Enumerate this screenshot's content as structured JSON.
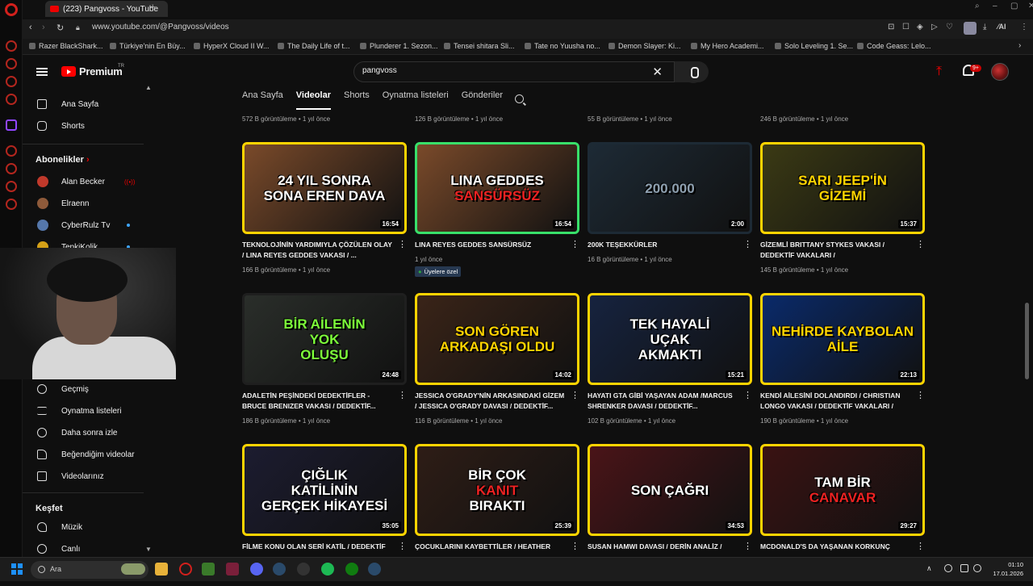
{
  "browser": {
    "tab_title": "(223) Pangvoss - YouTube",
    "tab_add": "+",
    "url": "www.youtube.com/@Pangvoss/videos",
    "bookmarks": [
      "Razer BlackShark...",
      "Türkiye'nin En Büy...",
      "HyperX Cloud II W...",
      "The Daily Life of t...",
      "Plunderer 1. Sezon...",
      "Tensei shitara Sli...",
      "Tate no Yuusha no...",
      "Demon Slayer: Ki...",
      "My Hero Academi...",
      "Solo Leveling 1. Se...",
      "Code Geass: Lelo..."
    ]
  },
  "header": {
    "brand": "Premium",
    "region": "TR",
    "search_value": "pangvoss",
    "clear": "✕",
    "upload": "⤒",
    "notification_count": "9+"
  },
  "sidebar": {
    "main": [
      {
        "label": "Ana Sayfa",
        "icon": "home-icon"
      },
      {
        "label": "Shorts",
        "icon": "shorts-icon"
      }
    ],
    "subscriptions_title": "Abonelikler",
    "subscriptions": [
      {
        "label": "Alan Becker",
        "color": "#c0392b"
      },
      {
        "label": "Elraenn",
        "color": "#8e5a3a"
      },
      {
        "label": "CyberRulz Tv",
        "color": "#5577aa"
      },
      {
        "label": "TepkiKolik",
        "color": "#d4a017"
      }
    ],
    "you": [
      {
        "label": "Geçmiş",
        "icon": "history-icon"
      },
      {
        "label": "Oynatma listeleri",
        "icon": "playlist-icon"
      },
      {
        "label": "Daha sonra izle",
        "icon": "watch-later-icon"
      },
      {
        "label": "Beğendiğim videolar",
        "icon": "like-icon"
      },
      {
        "label": "Videolarınız",
        "icon": "your-videos-icon"
      }
    ],
    "explore_title": "Keşfet",
    "explore": [
      {
        "label": "Müzik",
        "icon": "music-icon"
      },
      {
        "label": "Canlı",
        "icon": "live-icon"
      }
    ]
  },
  "channel_tabs": [
    "Ana Sayfa",
    "Videolar",
    "Shorts",
    "Oynatma listeleri",
    "Gönderiler"
  ],
  "previous_row_meta": [
    "572 B görüntüleme • 1 yıl önce",
    "126 B görüntüleme • 1 yıl önce",
    "55 B görüntüleme • 1 yıl önce",
    "246 B görüntüleme • 1 yıl önce"
  ],
  "videos": [
    {
      "thumb_lines": [
        "24 YIL SONRA",
        "SONA EREN DAVA"
      ],
      "duration": "16:54",
      "title": "TEKNOLOJİNİN YARDIMIYLA ÇÖZÜLEN OLAY / LINA REYES GEDDES VAKASI / ...",
      "meta": "166 B görüntüleme • 1 yıl önce",
      "border": "#ffd400",
      "bg": "#7a4a2a",
      "text_color": "#ffffff"
    },
    {
      "thumb_lines": [
        "LINA GEDDES",
        "SANSÜRSÜZ"
      ],
      "duration": "16:54",
      "title": "LINA REYES GEDDES SANSÜRSÜZ",
      "meta": "1 yıl önce",
      "badge": "Üyelere özel",
      "border": "#38e06a",
      "bg": "#7a4a2a",
      "text_color": "#ffffff"
    },
    {
      "thumb_lines": [
        "200.000"
      ],
      "duration": "2:00",
      "title": "200K TEŞEKKÜRLER",
      "meta": "16 B görüntüleme • 1 yıl önce",
      "border": "#1d2a35",
      "bg": "#1d2a35",
      "text_color": "#8ea0b0"
    },
    {
      "thumb_lines": [
        "SARI JEEP'İN",
        "GİZEMİ"
      ],
      "duration": "15:37",
      "title": "GİZEMLİ BRITTANY STYKES VAKASI / DEDEKTİF VAKALARI /",
      "meta": "145 B görüntüleme • 1 yıl önce",
      "border": "#ffd400",
      "bg": "#3b3a14",
      "text_color": "#ffd400"
    },
    {
      "thumb_lines": [
        "BİR AİLENİN",
        "YOK",
        "OLUŞU"
      ],
      "duration": "24:48",
      "title": "ADALETİN PEŞİNDEKİ DEDEKTİFLER - BRUCE BRENIZER VAKASI / DEDEKTİF...",
      "meta": "186 B görüntüleme • 1 yıl önce",
      "border": "#1f1f1f",
      "bg": "#2a2e2a",
      "text_color": "#7dff3a"
    },
    {
      "thumb_lines": [
        "SON GÖREN",
        "ARKADAŞI OLDU"
      ],
      "duration": "14:02",
      "title": "JESSICA O'GRADY'NİN ARKASINDAKİ GİZEM / JESSICA O'GRADY DAVASI / DEDEKTİF...",
      "meta": "116 B görüntüleme • 1 yıl önce",
      "border": "#ffd400",
      "bg": "#3a2418",
      "text_color": "#ffd400"
    },
    {
      "thumb_lines": [
        "TEK HAYALİ",
        "UÇAK",
        "AKMAKTI"
      ],
      "duration": "15:21",
      "title": "HAYATI GTA GİBİ YAŞAYAN ADAM /MARCUS SHRENKER DAVASI / DEDEKTİF...",
      "meta": "102 B görüntüleme • 1 yıl önce",
      "border": "#ffd400",
      "bg": "#16233f",
      "text_color": "#ffffff"
    },
    {
      "thumb_lines": [
        "NEHİRDE KAYBOLAN",
        "AİLE"
      ],
      "duration": "22:13",
      "title": "KENDİ AİLESİNİ DOLANDIRDI / CHRISTIAN LONGO VAKASI / DEDEKTİF VAKALARI /",
      "meta": "190 B görüntüleme • 1 yıl önce",
      "border": "#ffd400",
      "bg": "#0a2a6a",
      "text_color": "#ffd400"
    },
    {
      "thumb_lines": [
        "ÇIĞLIK",
        "KATİLİNİN",
        "GERÇEK HİKAYESİ"
      ],
      "duration": "35:05",
      "title": "FİLME KONU OLAN SERİ KATİL / DEDEKTİF",
      "meta": "",
      "border": "#ffd400",
      "bg": "#1c1c30",
      "text_color": "#ffffff"
    },
    {
      "thumb_lines": [
        "BİR ÇOK",
        "KANIT",
        "BIRAKTI"
      ],
      "duration": "25:39",
      "title": "ÇOCUKLARINI KAYBETTİLER / HEATHER",
      "meta": "",
      "border": "#ffd400",
      "bg": "#2e1d16",
      "text_color": "#ffffff"
    },
    {
      "thumb_lines": [
        "SON ÇAĞRI"
      ],
      "duration": "34:53",
      "title": "SUSAN HAMWI DAVASI / DERİN ANALİZ /",
      "meta": "",
      "border": "#ffd400",
      "bg": "#4a1418",
      "text_color": "#ffffff"
    },
    {
      "thumb_lines": [
        "TAM BİR",
        "CANAVAR"
      ],
      "duration": "29:27",
      "title": "MCDONALD'S DA YAŞANAN KORKUNÇ",
      "meta": "",
      "border": "#ffd400",
      "bg": "#3a1212",
      "text_color": "#ffffff"
    }
  ],
  "taskbar": {
    "search_label": "Ara",
    "time": "01:10",
    "date": "17.01.2026"
  }
}
